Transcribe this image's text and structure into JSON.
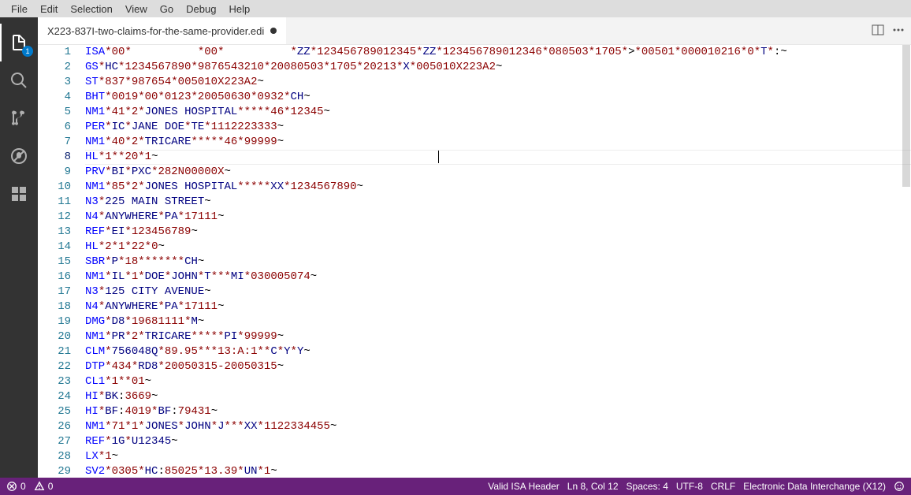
{
  "menu": {
    "items": [
      "File",
      "Edit",
      "Selection",
      "View",
      "Go",
      "Debug",
      "Help"
    ]
  },
  "activitybar": {
    "explorer_badge": "1"
  },
  "tab": {
    "title": "X223-837I-two-claims-for-the-same-provider.edi",
    "dirty": true
  },
  "editor": {
    "cursor_line": 8,
    "total_lines": 29,
    "lines": [
      {
        "seg": "ISA",
        "kwParts": [
          "ISA"
        ],
        "rest": "*00*          *00*          *ZZ*123456789012345*ZZ*123456789012346*080503*1705*>*00501*000010216*0*T*:~",
        "tokens": [
          [
            "sep",
            "*"
          ],
          [
            "num",
            "00"
          ],
          [
            "sep",
            "*"
          ],
          [
            "plain",
            "          "
          ],
          [
            "sep",
            "*"
          ],
          [
            "num",
            "00"
          ],
          [
            "sep",
            "*"
          ],
          [
            "plain",
            "          "
          ],
          [
            "sep",
            "*"
          ],
          [
            "str",
            "ZZ"
          ],
          [
            "sep",
            "*"
          ],
          [
            "num",
            "123456789012345"
          ],
          [
            "sep",
            "*"
          ],
          [
            "str",
            "ZZ"
          ],
          [
            "sep",
            "*"
          ],
          [
            "num",
            "123456789012346"
          ],
          [
            "sep",
            "*"
          ],
          [
            "num",
            "080503"
          ],
          [
            "sep",
            "*"
          ],
          [
            "num",
            "1705"
          ],
          [
            "sep",
            "*"
          ],
          [
            "plain",
            ">"
          ],
          [
            "sep",
            "*"
          ],
          [
            "num",
            "00501"
          ],
          [
            "sep",
            "*"
          ],
          [
            "num",
            "000010216"
          ],
          [
            "sep",
            "*"
          ],
          [
            "num",
            "0"
          ],
          [
            "sep",
            "*"
          ],
          [
            "str",
            "T"
          ],
          [
            "sep",
            "*"
          ],
          [
            "plain",
            ":~"
          ]
        ]
      },
      {
        "seg": "GS",
        "tokens": [
          [
            "sep",
            "*"
          ],
          [
            "str",
            "HC"
          ],
          [
            "sep",
            "*"
          ],
          [
            "num",
            "1234567890"
          ],
          [
            "sep",
            "*"
          ],
          [
            "num",
            "9876543210"
          ],
          [
            "sep",
            "*"
          ],
          [
            "num",
            "20080503"
          ],
          [
            "sep",
            "*"
          ],
          [
            "num",
            "1705"
          ],
          [
            "sep",
            "*"
          ],
          [
            "num",
            "20213"
          ],
          [
            "sep",
            "*"
          ],
          [
            "str",
            "X"
          ],
          [
            "sep",
            "*"
          ],
          [
            "num",
            "005010X223A2"
          ],
          [
            "plain",
            "~"
          ]
        ]
      },
      {
        "seg": "ST",
        "tokens": [
          [
            "sep",
            "*"
          ],
          [
            "num",
            "837"
          ],
          [
            "sep",
            "*"
          ],
          [
            "num",
            "987654"
          ],
          [
            "sep",
            "*"
          ],
          [
            "num",
            "005010X223A2"
          ],
          [
            "plain",
            "~"
          ]
        ]
      },
      {
        "seg": "BHT",
        "tokens": [
          [
            "sep",
            "*"
          ],
          [
            "num",
            "0019"
          ],
          [
            "sep",
            "*"
          ],
          [
            "num",
            "00"
          ],
          [
            "sep",
            "*"
          ],
          [
            "num",
            "0123"
          ],
          [
            "sep",
            "*"
          ],
          [
            "num",
            "20050630"
          ],
          [
            "sep",
            "*"
          ],
          [
            "num",
            "0932"
          ],
          [
            "sep",
            "*"
          ],
          [
            "str",
            "CH"
          ],
          [
            "plain",
            "~"
          ]
        ]
      },
      {
        "seg": "NM1",
        "tokens": [
          [
            "sep",
            "*"
          ],
          [
            "num",
            "41"
          ],
          [
            "sep",
            "*"
          ],
          [
            "num",
            "2"
          ],
          [
            "sep",
            "*"
          ],
          [
            "str",
            "JONES HOSPITAL"
          ],
          [
            "sep",
            "*****"
          ],
          [
            "num",
            "46"
          ],
          [
            "sep",
            "*"
          ],
          [
            "num",
            "12345"
          ],
          [
            "plain",
            "~"
          ]
        ]
      },
      {
        "seg": "PER",
        "tokens": [
          [
            "sep",
            "*"
          ],
          [
            "str",
            "IC"
          ],
          [
            "sep",
            "*"
          ],
          [
            "str",
            "JANE DOE"
          ],
          [
            "sep",
            "*"
          ],
          [
            "str",
            "TE"
          ],
          [
            "sep",
            "*"
          ],
          [
            "num",
            "1112223333"
          ],
          [
            "plain",
            "~"
          ]
        ]
      },
      {
        "seg": "NM1",
        "tokens": [
          [
            "sep",
            "*"
          ],
          [
            "num",
            "40"
          ],
          [
            "sep",
            "*"
          ],
          [
            "num",
            "2"
          ],
          [
            "sep",
            "*"
          ],
          [
            "str",
            "TRICARE"
          ],
          [
            "sep",
            "*****"
          ],
          [
            "num",
            "46"
          ],
          [
            "sep",
            "*"
          ],
          [
            "num",
            "99999"
          ],
          [
            "plain",
            "~"
          ]
        ]
      },
      {
        "seg": "HL",
        "tokens": [
          [
            "sep",
            "*"
          ],
          [
            "num",
            "1"
          ],
          [
            "sep",
            "**"
          ],
          [
            "num",
            "20"
          ],
          [
            "sep",
            "*"
          ],
          [
            "num",
            "1"
          ],
          [
            "plain",
            "~"
          ]
        ]
      },
      {
        "seg": "PRV",
        "tokens": [
          [
            "sep",
            "*"
          ],
          [
            "str",
            "BI"
          ],
          [
            "sep",
            "*"
          ],
          [
            "str",
            "PXC"
          ],
          [
            "sep",
            "*"
          ],
          [
            "num",
            "282N00000X"
          ],
          [
            "plain",
            "~"
          ]
        ]
      },
      {
        "seg": "NM1",
        "tokens": [
          [
            "sep",
            "*"
          ],
          [
            "num",
            "85"
          ],
          [
            "sep",
            "*"
          ],
          [
            "num",
            "2"
          ],
          [
            "sep",
            "*"
          ],
          [
            "str",
            "JONES HOSPITAL"
          ],
          [
            "sep",
            "*****"
          ],
          [
            "str",
            "XX"
          ],
          [
            "sep",
            "*"
          ],
          [
            "num",
            "1234567890"
          ],
          [
            "plain",
            "~"
          ]
        ]
      },
      {
        "seg": "N3",
        "tokens": [
          [
            "sep",
            "*"
          ],
          [
            "str",
            "225 MAIN STREET"
          ],
          [
            "plain",
            "~"
          ]
        ]
      },
      {
        "seg": "N4",
        "tokens": [
          [
            "sep",
            "*"
          ],
          [
            "str",
            "ANYWHERE"
          ],
          [
            "sep",
            "*"
          ],
          [
            "str",
            "PA"
          ],
          [
            "sep",
            "*"
          ],
          [
            "num",
            "17111"
          ],
          [
            "plain",
            "~"
          ]
        ]
      },
      {
        "seg": "REF",
        "tokens": [
          [
            "sep",
            "*"
          ],
          [
            "str",
            "EI"
          ],
          [
            "sep",
            "*"
          ],
          [
            "num",
            "123456789"
          ],
          [
            "plain",
            "~"
          ]
        ]
      },
      {
        "seg": "HL",
        "tokens": [
          [
            "sep",
            "*"
          ],
          [
            "num",
            "2"
          ],
          [
            "sep",
            "*"
          ],
          [
            "num",
            "1"
          ],
          [
            "sep",
            "*"
          ],
          [
            "num",
            "22"
          ],
          [
            "sep",
            "*"
          ],
          [
            "num",
            "0"
          ],
          [
            "plain",
            "~"
          ]
        ]
      },
      {
        "seg": "SBR",
        "tokens": [
          [
            "sep",
            "*"
          ],
          [
            "str",
            "P"
          ],
          [
            "sep",
            "*"
          ],
          [
            "num",
            "18"
          ],
          [
            "sep",
            "*******"
          ],
          [
            "str",
            "CH"
          ],
          [
            "plain",
            "~"
          ]
        ]
      },
      {
        "seg": "NM1",
        "tokens": [
          [
            "sep",
            "*"
          ],
          [
            "str",
            "IL"
          ],
          [
            "sep",
            "*"
          ],
          [
            "num",
            "1"
          ],
          [
            "sep",
            "*"
          ],
          [
            "str",
            "DOE"
          ],
          [
            "sep",
            "*"
          ],
          [
            "str",
            "JOHN"
          ],
          [
            "sep",
            "*"
          ],
          [
            "str",
            "T"
          ],
          [
            "sep",
            "***"
          ],
          [
            "str",
            "MI"
          ],
          [
            "sep",
            "*"
          ],
          [
            "num",
            "030005074"
          ],
          [
            "plain",
            "~"
          ]
        ]
      },
      {
        "seg": "N3",
        "tokens": [
          [
            "sep",
            "*"
          ],
          [
            "str",
            "125 CITY AVENUE"
          ],
          [
            "plain",
            "~"
          ]
        ]
      },
      {
        "seg": "N4",
        "tokens": [
          [
            "sep",
            "*"
          ],
          [
            "str",
            "ANYWHERE"
          ],
          [
            "sep",
            "*"
          ],
          [
            "str",
            "PA"
          ],
          [
            "sep",
            "*"
          ],
          [
            "num",
            "17111"
          ],
          [
            "plain",
            "~"
          ]
        ]
      },
      {
        "seg": "DMG",
        "tokens": [
          [
            "sep",
            "*"
          ],
          [
            "str",
            "D8"
          ],
          [
            "sep",
            "*"
          ],
          [
            "num",
            "19681111"
          ],
          [
            "sep",
            "*"
          ],
          [
            "str",
            "M"
          ],
          [
            "plain",
            "~"
          ]
        ]
      },
      {
        "seg": "NM1",
        "tokens": [
          [
            "sep",
            "*"
          ],
          [
            "str",
            "PR"
          ],
          [
            "sep",
            "*"
          ],
          [
            "num",
            "2"
          ],
          [
            "sep",
            "*"
          ],
          [
            "str",
            "TRICARE"
          ],
          [
            "sep",
            "*****"
          ],
          [
            "str",
            "PI"
          ],
          [
            "sep",
            "*"
          ],
          [
            "num",
            "99999"
          ],
          [
            "plain",
            "~"
          ]
        ]
      },
      {
        "seg": "CLM",
        "tokens": [
          [
            "sep",
            "*"
          ],
          [
            "str",
            "756048Q"
          ],
          [
            "sep",
            "*"
          ],
          [
            "num",
            "89.95"
          ],
          [
            "sep",
            "***"
          ],
          [
            "num",
            "13:A:1"
          ],
          [
            "sep",
            "**"
          ],
          [
            "str",
            "C"
          ],
          [
            "sep",
            "*"
          ],
          [
            "str",
            "Y"
          ],
          [
            "sep",
            "*"
          ],
          [
            "str",
            "Y"
          ],
          [
            "plain",
            "~"
          ]
        ]
      },
      {
        "seg": "DTP",
        "tokens": [
          [
            "sep",
            "*"
          ],
          [
            "num",
            "434"
          ],
          [
            "sep",
            "*"
          ],
          [
            "str",
            "RD8"
          ],
          [
            "sep",
            "*"
          ],
          [
            "num",
            "20050315-20050315"
          ],
          [
            "plain",
            "~"
          ]
        ]
      },
      {
        "seg": "CL1",
        "tokens": [
          [
            "sep",
            "*"
          ],
          [
            "num",
            "1"
          ],
          [
            "sep",
            "**"
          ],
          [
            "num",
            "01"
          ],
          [
            "plain",
            "~"
          ]
        ]
      },
      {
        "seg": "HI",
        "tokens": [
          [
            "sep",
            "*"
          ],
          [
            "str",
            "BK"
          ],
          [
            "plain",
            ":"
          ],
          [
            "num",
            "3669"
          ],
          [
            "plain",
            "~"
          ]
        ]
      },
      {
        "seg": "HI",
        "tokens": [
          [
            "sep",
            "*"
          ],
          [
            "str",
            "BF"
          ],
          [
            "plain",
            ":"
          ],
          [
            "num",
            "4019"
          ],
          [
            "sep",
            "*"
          ],
          [
            "str",
            "BF"
          ],
          [
            "plain",
            ":"
          ],
          [
            "num",
            "79431"
          ],
          [
            "plain",
            "~"
          ]
        ]
      },
      {
        "seg": "NM1",
        "tokens": [
          [
            "sep",
            "*"
          ],
          [
            "num",
            "71"
          ],
          [
            "sep",
            "*"
          ],
          [
            "num",
            "1"
          ],
          [
            "sep",
            "*"
          ],
          [
            "str",
            "JONES"
          ],
          [
            "sep",
            "*"
          ],
          [
            "str",
            "JOHN"
          ],
          [
            "sep",
            "*"
          ],
          [
            "str",
            "J"
          ],
          [
            "sep",
            "***"
          ],
          [
            "str",
            "XX"
          ],
          [
            "sep",
            "*"
          ],
          [
            "num",
            "1122334455"
          ],
          [
            "plain",
            "~"
          ]
        ]
      },
      {
        "seg": "REF",
        "tokens": [
          [
            "sep",
            "*"
          ],
          [
            "str",
            "1G"
          ],
          [
            "sep",
            "*"
          ],
          [
            "str",
            "U12345"
          ],
          [
            "plain",
            "~"
          ]
        ]
      },
      {
        "seg": "LX",
        "tokens": [
          [
            "sep",
            "*"
          ],
          [
            "num",
            "1"
          ],
          [
            "plain",
            "~"
          ]
        ]
      },
      {
        "seg": "SV2",
        "tokens": [
          [
            "sep",
            "*"
          ],
          [
            "num",
            "0305"
          ],
          [
            "sep",
            "*"
          ],
          [
            "str",
            "HC"
          ],
          [
            "plain",
            ":"
          ],
          [
            "num",
            "85025"
          ],
          [
            "sep",
            "*"
          ],
          [
            "num",
            "13.39"
          ],
          [
            "sep",
            "*"
          ],
          [
            "str",
            "UN"
          ],
          [
            "sep",
            "*"
          ],
          [
            "num",
            "1"
          ],
          [
            "plain",
            "~"
          ]
        ]
      }
    ]
  },
  "statusbar": {
    "errors": "0",
    "warnings": "0",
    "validation": "Valid ISA Header",
    "position": "Ln 8, Col 12",
    "spaces": "Spaces: 4",
    "encoding": "UTF-8",
    "eol": "CRLF",
    "language": "Electronic Data Interchange (X12)"
  }
}
